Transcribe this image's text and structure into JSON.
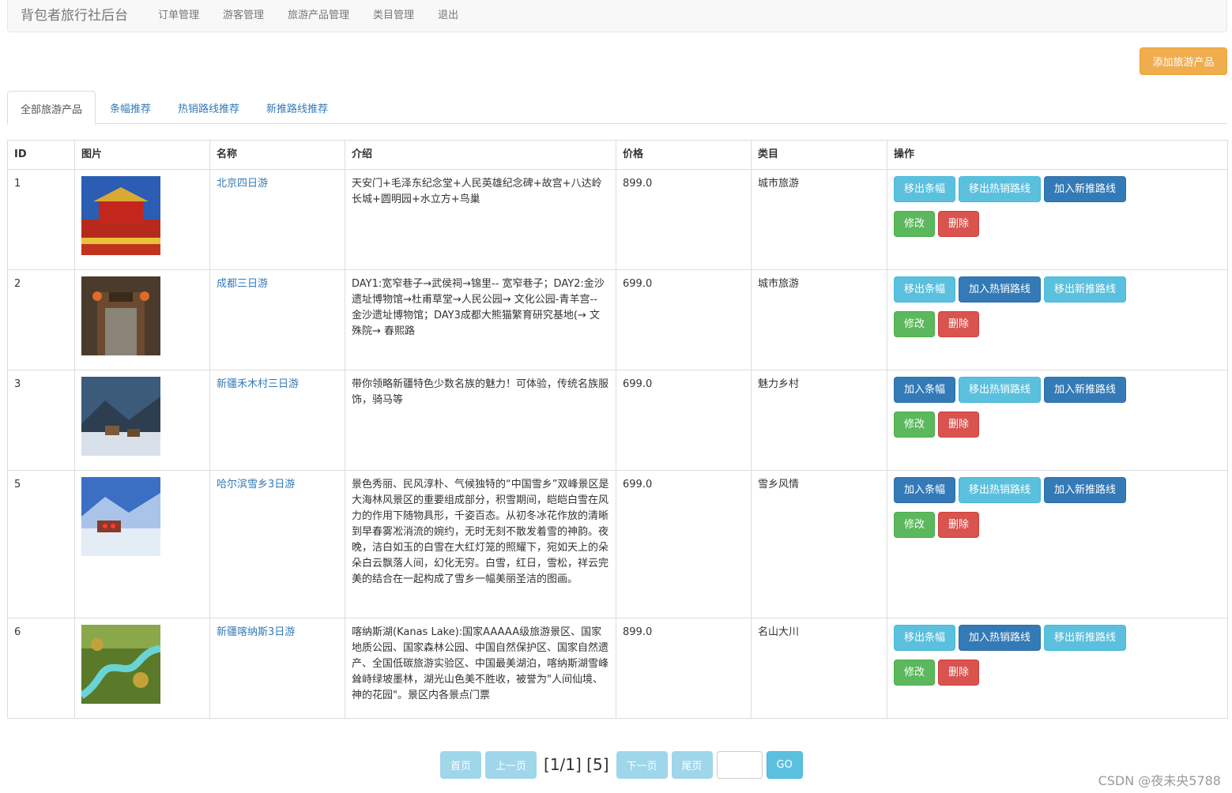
{
  "nav": {
    "brand": "背包者旅行社后台",
    "links": [
      "订单管理",
      "游客管理",
      "旅游产品管理",
      "类目管理",
      "退出"
    ]
  },
  "add_button": "添加旅游产品",
  "tabs": [
    "全部旅游产品",
    "条幅推荐",
    "热销路线推荐",
    "新推路线推荐"
  ],
  "table": {
    "headers": [
      "ID",
      "图片",
      "名称",
      "介绍",
      "价格",
      "类目",
      "操作"
    ],
    "rows": [
      {
        "id": "1",
        "name": "北京四日游",
        "intro": "天安门+毛泽东纪念堂+人民英雄纪念碑+故宫+八达岭长城+圆明园+水立方+鸟巢",
        "price": "899.0",
        "category": "城市旅游",
        "ops": [
          "移出条幅",
          "移出热销路线",
          "加入新推路线"
        ],
        "edit": "修改",
        "delete": "删除"
      },
      {
        "id": "2",
        "name": "成都三日游",
        "intro": "DAY1:宽窄巷子→武侯祠→锦里-- 宽窄巷子；DAY2:金沙遗址博物馆→杜甫草堂→人民公园→ 文化公园-青羊宫-- 金沙遗址博物馆；DAY3成都大熊猫繁育研究基地(→ 文殊院→ 春熙路",
        "price": "699.0",
        "category": "城市旅游",
        "ops": [
          "移出条幅",
          "加入热销路线",
          "移出新推路线"
        ],
        "edit": "修改",
        "delete": "删除"
      },
      {
        "id": "3",
        "name": "新疆禾木村三日游",
        "intro": "带你领略新疆特色少数名族的魅力！可体验，传统名族服饰，骑马等",
        "price": "699.0",
        "category": "魅力乡村",
        "ops": [
          "加入条幅",
          "移出热销路线",
          "加入新推路线"
        ],
        "edit": "修改",
        "delete": "删除"
      },
      {
        "id": "5",
        "name": "哈尔滨雪乡3日游",
        "intro": "景色秀丽、民风淳朴、气候独特的“中国雪乡”双峰景区是大海林风景区的重要组成部分，积雪期间，皑皑白雪在风力的作用下随物具形，千姿百态。从初冬冰花作放的清晰到早春雾凇消流的婉约，无时无刻不散发着雪的神韵。夜晚，洁白如玉的白雪在大红灯笼的照耀下，宛如天上的朵朵白云飘落人间，幻化无穷。白雪，红日，雪松，祥云完美的结合在一起构成了雪乡一幅美丽圣洁的图画。",
        "price": "699.0",
        "category": "雪乡风情",
        "ops": [
          "加入条幅",
          "移出热销路线",
          "加入新推路线"
        ],
        "edit": "修改",
        "delete": "删除"
      },
      {
        "id": "6",
        "name": "新疆喀纳斯3日游",
        "intro": "喀纳斯湖(Kanas Lake):国家AAAAA级旅游景区、国家地质公园、国家森林公园、中国自然保护区、国家自然遗产、全国低碳旅游实验区、中国最美湖泊，喀纳斯湖雪峰耸峙绿坡墨林，湖光山色美不胜收，被誉为\"人间仙境、神的花园\"。景区内各景点门票",
        "price": "899.0",
        "category": "名山大川",
        "ops": [
          "移出条幅",
          "加入热销路线",
          "移出新推路线"
        ],
        "edit": "修改",
        "delete": "删除"
      }
    ]
  },
  "pager": {
    "first": "首页",
    "prev": "上一页",
    "info": "[1/1] [5]",
    "next": "下一页",
    "last": "尾页",
    "go": "GO"
  },
  "watermark": "CSDN @夜未央5788"
}
